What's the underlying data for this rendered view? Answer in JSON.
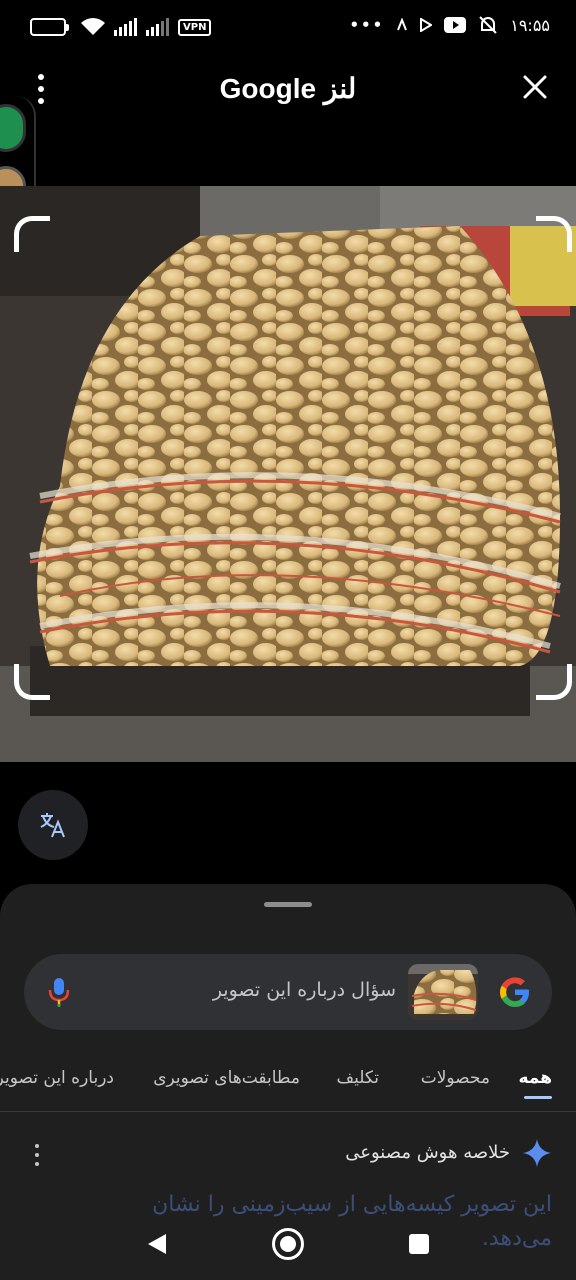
{
  "status_bar": {
    "battery": "39",
    "vpn": "VPN",
    "time": "۱۹:۵۵",
    "overflow": "•••",
    "icons": [
      "wifi-icon",
      "signal-icon",
      "signal-icon",
      "nfc-icon",
      "play-icon",
      "youtube-icon",
      "alarm-off-icon"
    ]
  },
  "app_bar": {
    "title": "لنز Google"
  },
  "search": {
    "placeholder": "سؤال درباره این تصویر"
  },
  "tabs": [
    {
      "label": "همه",
      "active": true
    },
    {
      "label": "محصولات"
    },
    {
      "label": "تکلیف"
    },
    {
      "label": "مطابقت‌های تصویری"
    },
    {
      "label": "درباره این تصویر"
    }
  ],
  "ai_overview": {
    "label": "خلاصه هوش مصنوعی",
    "text": "این تصویر کیسه‌هایی از سیب‌زمینی را نشان می‌دهد."
  },
  "colors": {
    "accent": "#a8c7fa",
    "sheet_bg": "#1f1f1f",
    "search_bg": "#303134"
  }
}
